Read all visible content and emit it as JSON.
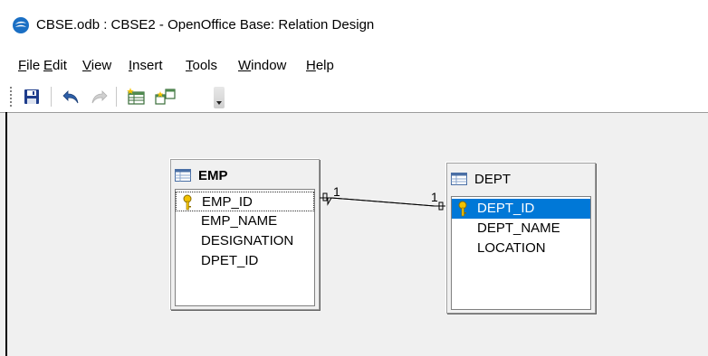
{
  "window": {
    "title": "CBSE.odb : CBSE2 - OpenOffice Base: Relation Design",
    "app_icon": "openoffice-logo-icon"
  },
  "menu": [
    {
      "pre": "",
      "acc": "F",
      "post": "ile"
    },
    {
      "pre": "",
      "acc": "E",
      "post": "dit"
    },
    {
      "pre": "",
      "acc": "V",
      "post": "iew"
    },
    {
      "pre": "",
      "acc": "I",
      "post": "nsert"
    },
    {
      "pre": "",
      "acc": "T",
      "post": "ools"
    },
    {
      "pre": "",
      "acc": "W",
      "post": "indow"
    },
    {
      "pre": "",
      "acc": "H",
      "post": "elp"
    }
  ],
  "toolbar": {
    "buttons": [
      "save-icon",
      "undo-icon",
      "redo-icon",
      "add-tables-icon",
      "new-relation-icon"
    ],
    "colors": {
      "accent_blue": "#0078d7",
      "save_blue": "#1f3d8c"
    }
  },
  "tables": {
    "emp": {
      "title": "EMP",
      "fields": [
        "EMP_ID",
        "EMP_NAME",
        "DESIGNATION",
        "DPET_ID"
      ],
      "primary_key": "EMP_ID"
    },
    "dept": {
      "title": "DEPT",
      "fields": [
        "DEPT_ID",
        "DEPT_NAME",
        "LOCATION"
      ],
      "primary_key": "DEPT_ID"
    }
  },
  "relation": {
    "from_cardinality": "1",
    "to_cardinality": "1"
  }
}
